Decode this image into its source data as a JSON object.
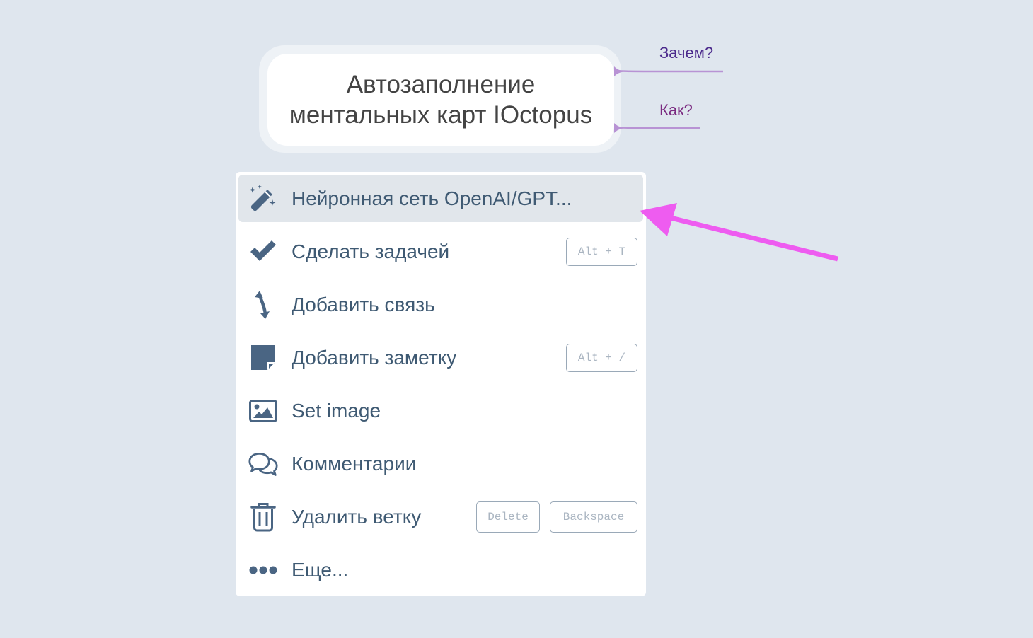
{
  "mind_map": {
    "root_title_line1": "Автозаполнение",
    "root_title_line2": "ментальных карт IOctopus",
    "branches": [
      {
        "label": "Зачем?",
        "color": "#4b2a8c"
      },
      {
        "label": "Как?",
        "color": "#7a2a80"
      }
    ],
    "connector_color": "#b893d4"
  },
  "context_menu": {
    "items": [
      {
        "label": "Нейронная сеть OpenAI/GPT...",
        "icon": "magic-wand-icon",
        "active": true,
        "shortcuts": []
      },
      {
        "label": "Сделать задачей",
        "icon": "checkmark-icon",
        "shortcuts": [
          "Alt + T"
        ]
      },
      {
        "label": "Добавить связь",
        "icon": "curved-double-arrow-icon",
        "shortcuts": []
      },
      {
        "label": "Добавить заметку",
        "icon": "sticky-note-icon",
        "shortcuts": [
          "Alt + /"
        ]
      },
      {
        "label": "Set image",
        "icon": "image-icon",
        "shortcuts": []
      },
      {
        "label": "Комментарии",
        "icon": "comments-icon",
        "shortcuts": []
      },
      {
        "label": "Удалить ветку",
        "icon": "trash-icon",
        "shortcuts": [
          "Delete",
          "Backspace"
        ]
      },
      {
        "label": "Еще...",
        "icon": "ellipsis-icon",
        "shortcuts": []
      }
    ]
  },
  "colors": {
    "background": "#dfe6ee",
    "menu_text": "#3f5a73",
    "icon": "#4a6583",
    "annotation_arrow": "#ee5cf0"
  }
}
